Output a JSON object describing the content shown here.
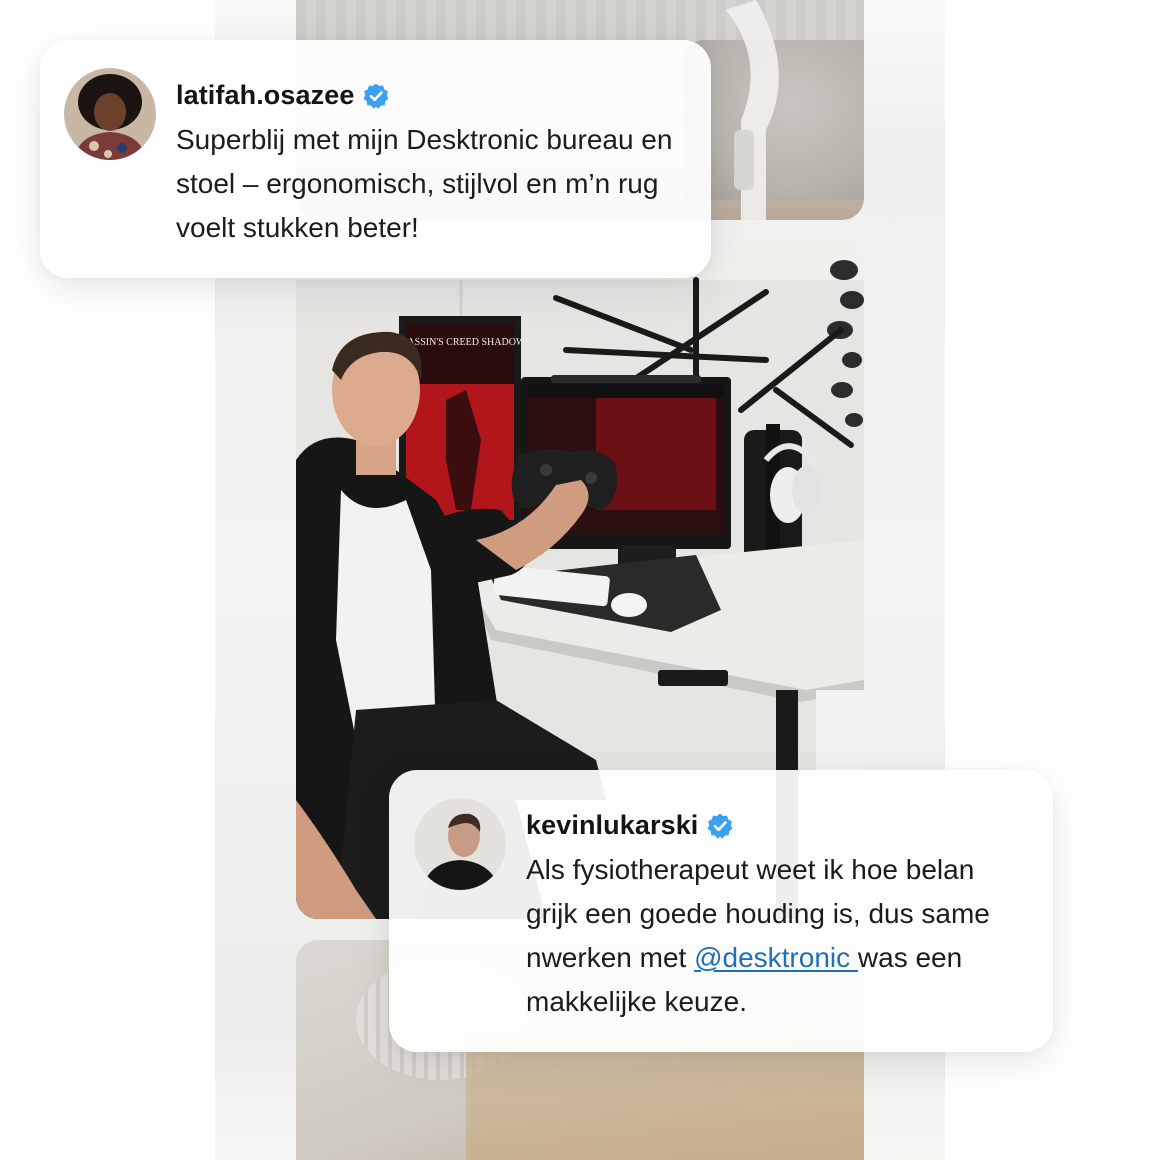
{
  "reviews": [
    {
      "handle": "latifah.osazee",
      "verified": true,
      "text": "Superblij met mijn Desktronic bureau en stoel – ergonomisch, stijlvol en m’n rug voelt stukken beter!"
    },
    {
      "handle": "kevinlukarski",
      "verified": true,
      "text_before": "Als fysiotherapeut weet ik hoe belan grijk een goede houding is, dus same nwerken met ",
      "mention": "@desktronic ",
      "text_after": "was een makkelijke keuze."
    }
  ],
  "photo": {
    "poster_text": "ASSASSIN'S CREED SHADOWS"
  },
  "colors": {
    "verified_badge": "#3aa0f0",
    "mention_link": "#1f6fb8",
    "card_background": "#ffffff",
    "text": "#1c1c1c"
  },
  "icons": {
    "verified": "verified-check-badge"
  }
}
